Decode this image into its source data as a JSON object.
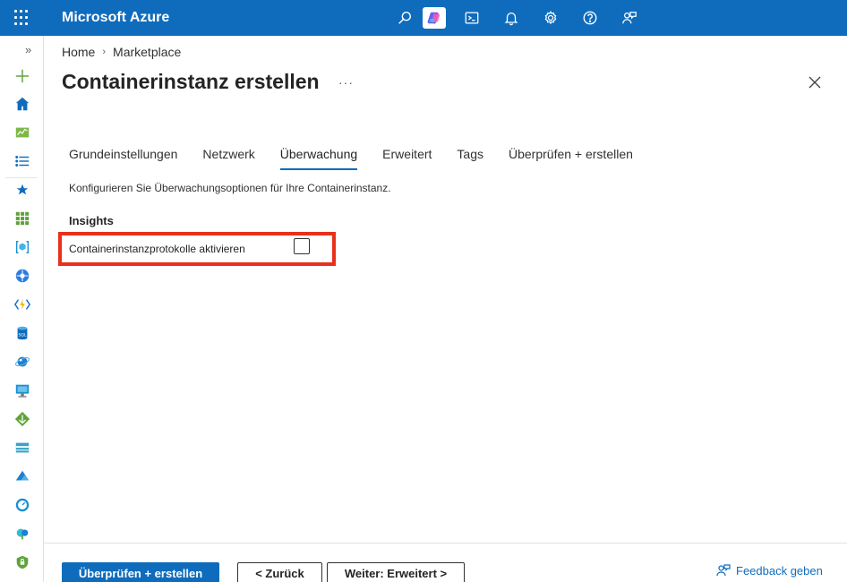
{
  "topbar": {
    "brand": "Microsoft Azure",
    "icons": [
      "waffle-icon",
      "search-icon",
      "copilot-icon",
      "cloud-shell-icon",
      "notifications-icon",
      "settings-icon",
      "help-icon",
      "feedback-icon"
    ]
  },
  "rail": {
    "expand_glyph": "»",
    "icons": [
      "create-resource-icon",
      "home-icon",
      "dashboard-icon",
      "all-services-icon",
      "favorites-star-icon",
      "all-resources-icon",
      "resource-groups-icon",
      "kubernetes-icon",
      "function-app-icon",
      "sql-database-icon",
      "cosmos-db-icon",
      "virtual-machine-icon",
      "load-balancer-icon",
      "storage-account-icon",
      "virtual-network-icon",
      "monitor-icon",
      "advisor-icon",
      "security-center-icon"
    ]
  },
  "breadcrumb": {
    "home": "Home",
    "separator": "›",
    "current": "Marketplace"
  },
  "page": {
    "title": "Containerinstanz erstellen",
    "more": "···"
  },
  "tabs": [
    {
      "label": "Grundeinstellungen",
      "active": false
    },
    {
      "label": "Netzwerk",
      "active": false
    },
    {
      "label": "Überwachung",
      "active": true
    },
    {
      "label": "Erweitert",
      "active": false
    },
    {
      "label": "Tags",
      "active": false
    },
    {
      "label": "Überprüfen + erstellen",
      "active": false
    }
  ],
  "content": {
    "description": "Konfigurieren Sie Überwachungsoptionen für Ihre Containerinstanz.",
    "section_heading": "Insights",
    "field_label": "Containerinstanzprotokolle aktivieren",
    "checkbox_checked": false
  },
  "footer": {
    "primary": "Überprüfen + erstellen",
    "back": "< Zurück",
    "next": "Weiter: Erweitert >",
    "feedback": "Feedback geben"
  },
  "colors": {
    "accent": "#0f6cbd",
    "highlight": "#e8311a"
  }
}
